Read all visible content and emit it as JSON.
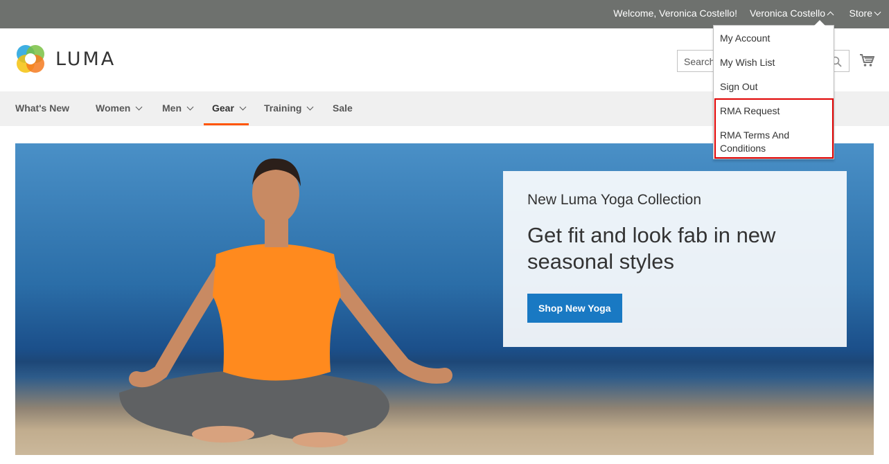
{
  "topbar": {
    "welcome": "Welcome, Veronica Costello!",
    "account_name": "Veronica Costello",
    "store": "Store"
  },
  "header": {
    "logo_text": "LUMA",
    "search_placeholder": "Search entire store here..."
  },
  "nav": {
    "items": [
      {
        "label": "What's New"
      },
      {
        "label": "Women"
      },
      {
        "label": "Men"
      },
      {
        "label": "Gear"
      },
      {
        "label": "Training"
      },
      {
        "label": "Sale"
      }
    ]
  },
  "account_menu": {
    "items": [
      {
        "label": "My Account"
      },
      {
        "label": "My Wish List"
      },
      {
        "label": "Sign Out"
      },
      {
        "label": "RMA Request"
      },
      {
        "label": "RMA Terms And Conditions"
      }
    ]
  },
  "hero": {
    "subtitle": "New Luma Yoga Collection",
    "headline": "Get fit and look fab in new seasonal styles",
    "button": "Shop New Yoga"
  },
  "colors": {
    "topbar": "#6e716e",
    "accent": "#ff5501",
    "button": "#1979c3",
    "highlight": "#e00000"
  }
}
